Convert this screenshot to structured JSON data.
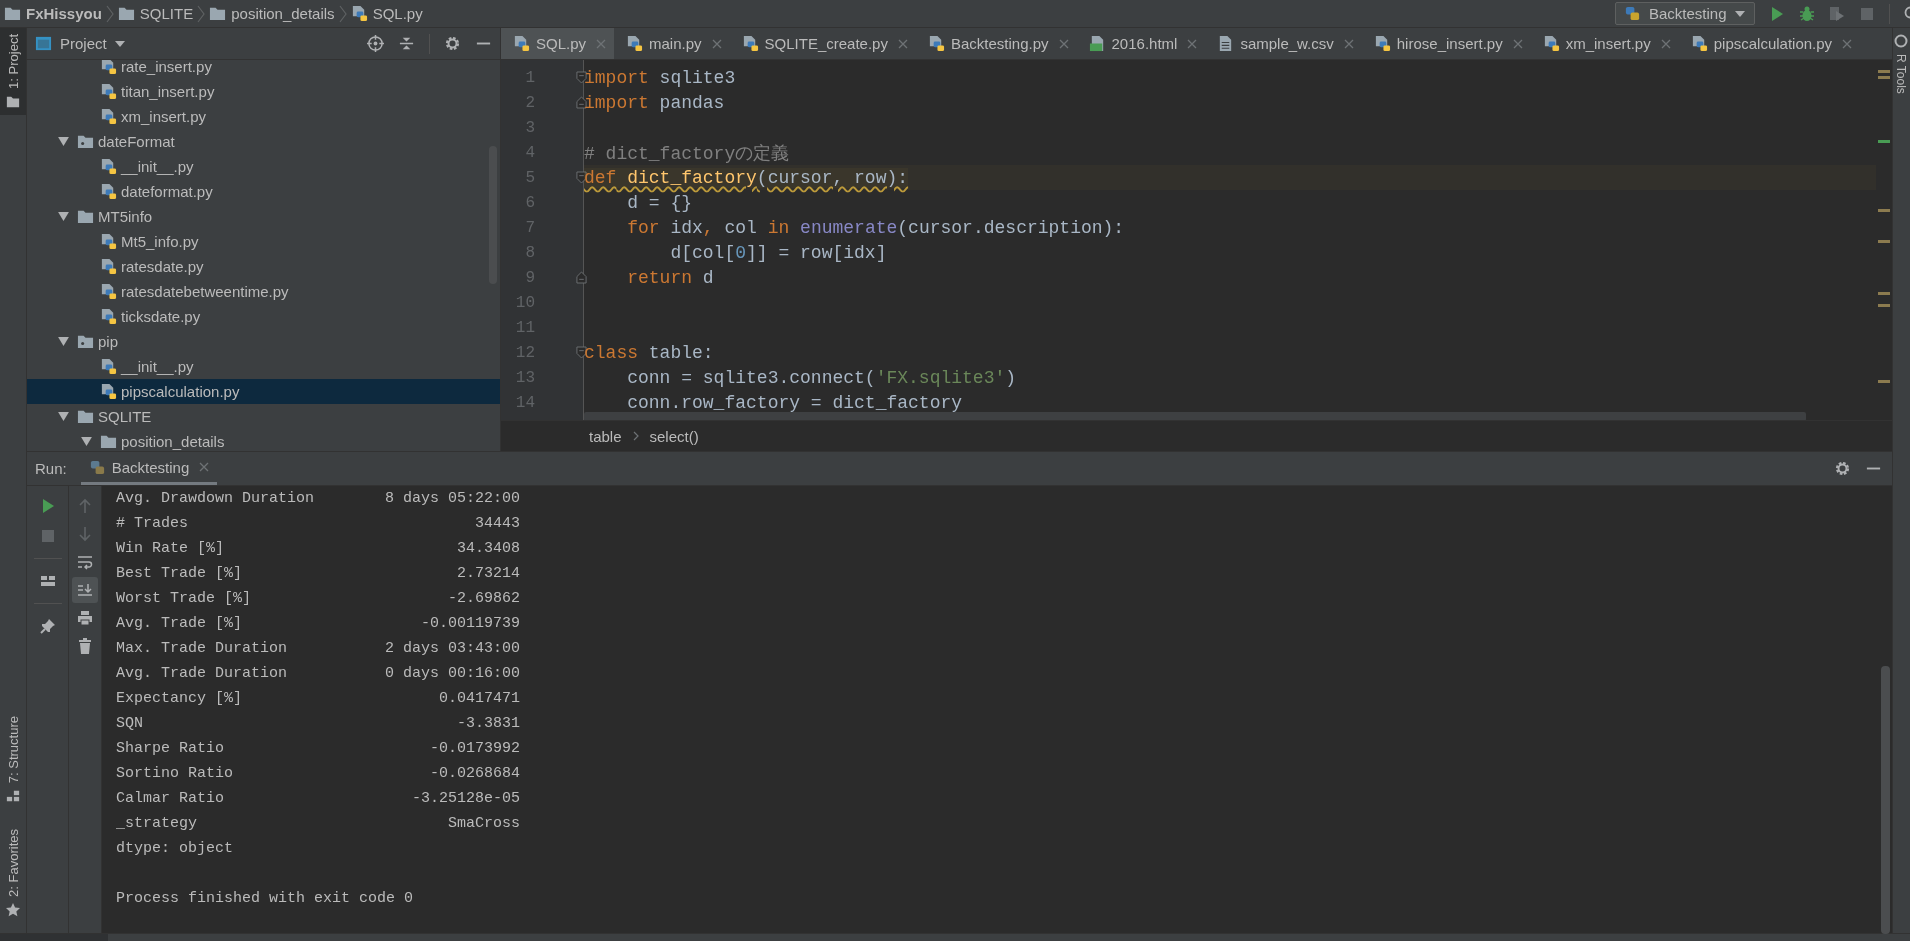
{
  "breadcrumbs": [
    {
      "label": "FxHissyou",
      "kind": "project"
    },
    {
      "label": "SQLITE",
      "kind": "folder"
    },
    {
      "label": "position_details",
      "kind": "folder"
    },
    {
      "label": "SQL.py",
      "kind": "python"
    }
  ],
  "run_config": {
    "label": "Backtesting"
  },
  "left_tool_tabs_top": [
    {
      "label": "1: Project",
      "kind": "project",
      "selected": true
    }
  ],
  "left_tool_tabs_bottom": [
    {
      "label": "7: Structure",
      "kind": "structure",
      "selected": false
    },
    {
      "label": "2: Favorites",
      "kind": "favorites",
      "selected": false
    }
  ],
  "right_tool_tabs": [
    {
      "label": "R Tools",
      "selected": false
    }
  ],
  "project_panel": {
    "title": "Project",
    "tree": [
      {
        "name": "rate_insert.py",
        "kind": "file",
        "selected": false
      },
      {
        "name": "titan_insert.py",
        "kind": "file",
        "selected": false
      },
      {
        "name": "xm_insert.py",
        "kind": "file",
        "selected": false
      },
      {
        "name": "dateFormat",
        "kind": "package",
        "expanded": true,
        "selected": false,
        "children": [
          {
            "name": "__init__.py",
            "kind": "file",
            "selected": false
          },
          {
            "name": "dateformat.py",
            "kind": "file",
            "selected": false
          }
        ]
      },
      {
        "name": "MT5info",
        "kind": "folder",
        "expanded": true,
        "selected": false,
        "children": [
          {
            "name": "Mt5_info.py",
            "kind": "file",
            "selected": false
          },
          {
            "name": "ratesdate.py",
            "kind": "file",
            "selected": false
          },
          {
            "name": "ratesdatebetweentime.py",
            "kind": "file",
            "selected": false
          },
          {
            "name": "ticksdate.py",
            "kind": "file",
            "selected": false
          }
        ]
      },
      {
        "name": "pip",
        "kind": "package",
        "expanded": true,
        "selected": false,
        "children": [
          {
            "name": "__init__.py",
            "kind": "file",
            "selected": false
          },
          {
            "name": "pipscalculation.py",
            "kind": "file",
            "selected": true
          }
        ]
      },
      {
        "name": "SQLITE",
        "kind": "folder",
        "expanded": true,
        "selected": false,
        "children": [
          {
            "name": "position_details",
            "kind": "folder",
            "expanded": true,
            "selected": false
          }
        ]
      }
    ]
  },
  "editor": {
    "tabs": [
      {
        "label": "SQL.py",
        "kind": "python",
        "selected": true
      },
      {
        "label": "main.py",
        "kind": "python",
        "selected": false
      },
      {
        "label": "SQLITE_create.py",
        "kind": "python",
        "selected": false
      },
      {
        "label": "Backtesting.py",
        "kind": "python",
        "selected": false
      },
      {
        "label": "2016.html",
        "kind": "html",
        "selected": false
      },
      {
        "label": "sample_w.csv",
        "kind": "text",
        "selected": false
      },
      {
        "label": "hirose_insert.py",
        "kind": "python",
        "selected": false
      },
      {
        "label": "xm_insert.py",
        "kind": "python",
        "selected": false
      },
      {
        "label": "pipscalculation.py",
        "kind": "python",
        "selected": false
      }
    ],
    "lines": [
      {
        "number": "1",
        "fold_open": true,
        "fold_close": false,
        "warning": false,
        "tokens": [
          {
            "kind": "keyword",
            "text": "import"
          },
          {
            "kind": "plain",
            "text": " sqlite3"
          }
        ]
      },
      {
        "number": "2",
        "fold_open": false,
        "fold_close": true,
        "warning": false,
        "tokens": [
          {
            "kind": "keyword",
            "text": "import"
          },
          {
            "kind": "plain",
            "text": " pandas"
          }
        ]
      },
      {
        "number": "3",
        "fold_open": false,
        "fold_close": false,
        "warning": false
      },
      {
        "number": "4",
        "fold_open": false,
        "fold_close": false,
        "warning": false,
        "tokens": [
          {
            "kind": "comment",
            "text": "# dict_factoryの定義"
          }
        ]
      },
      {
        "number": "5",
        "fold_open": true,
        "fold_close": false,
        "warning": true,
        "tokens": [
          {
            "kind": "keyword",
            "text": "def"
          },
          {
            "kind": "function",
            "text": " dict_factory"
          },
          {
            "kind": "plain",
            "text": "(cursor, row):"
          }
        ]
      },
      {
        "number": "6",
        "fold_open": false,
        "fold_close": false,
        "warning": false,
        "tokens": [
          {
            "kind": "plain",
            "text": "    d = {}"
          }
        ]
      },
      {
        "number": "7",
        "fold_open": false,
        "fold_close": false,
        "warning": false,
        "tokens": [
          {
            "kind": "keyword",
            "text": "    for"
          },
          {
            "kind": "plain",
            "text": " idx"
          },
          {
            "kind": "keyword",
            "text": ","
          },
          {
            "kind": "plain",
            "text": " col "
          },
          {
            "kind": "keyword",
            "text": "in"
          },
          {
            "kind": "builtin",
            "text": " enumerate"
          },
          {
            "kind": "plain",
            "text": "(cursor.description):"
          }
        ]
      },
      {
        "number": "8",
        "fold_open": false,
        "fold_close": false,
        "warning": false,
        "tokens": [
          {
            "kind": "plain",
            "text": "        d[col["
          },
          {
            "kind": "number",
            "text": "0"
          },
          {
            "kind": "plain",
            "text": "]] = row[idx]"
          }
        ]
      },
      {
        "number": "9",
        "fold_open": false,
        "fold_close": true,
        "warning": false,
        "tokens": [
          {
            "kind": "keyword",
            "text": "    return"
          },
          {
            "kind": "plain",
            "text": " d"
          }
        ]
      },
      {
        "number": "10",
        "fold_open": false,
        "fold_close": false,
        "warning": false
      },
      {
        "number": "11",
        "fold_open": false,
        "fold_close": false,
        "warning": false
      },
      {
        "number": "12",
        "fold_open": true,
        "fold_close": false,
        "warning": false,
        "tokens": [
          {
            "kind": "keyword",
            "text": "class"
          },
          {
            "kind": "plain",
            "text": " table:"
          }
        ]
      },
      {
        "number": "13",
        "fold_open": false,
        "fold_close": false,
        "warning": false,
        "tokens": [
          {
            "kind": "plain",
            "text": "    conn = sqlite3.connect("
          },
          {
            "kind": "string",
            "text": "'FX.sqlite3'"
          },
          {
            "kind": "plain",
            "text": ")"
          }
        ]
      },
      {
        "number": "14",
        "fold_open": false,
        "fold_close": false,
        "warning": false,
        "tokens": [
          {
            "kind": "plain",
            "text": "    conn.row_factory = dict_factory"
          }
        ]
      }
    ],
    "breadcrumb": [
      "table",
      "select()"
    ]
  },
  "run_panel": {
    "title": "Run:",
    "tab": {
      "label": "Backtesting",
      "selected": true
    },
    "rows": [
      {
        "label": "Avg. Drawdown Duration",
        "value": "8 days 05:22:00"
      },
      {
        "label": "# Trades",
        "value": "34443"
      },
      {
        "label": "Win Rate [%]",
        "value": "34.3408"
      },
      {
        "label": "Best Trade [%]",
        "value": "2.73214"
      },
      {
        "label": "Worst Trade [%]",
        "value": "-2.69862"
      },
      {
        "label": "Avg. Trade [%]",
        "value": "-0.00119739"
      },
      {
        "label": "Max. Trade Duration",
        "value": "2 days 03:43:00"
      },
      {
        "label": "Avg. Trade Duration",
        "value": "0 days 00:16:00"
      },
      {
        "label": "Expectancy [%]",
        "value": "0.0417471"
      },
      {
        "label": "SQN",
        "value": "-3.3831"
      },
      {
        "label": "Sharpe Ratio",
        "value": "-0.0173992"
      },
      {
        "label": "Sortino Ratio",
        "value": "-0.0268684"
      },
      {
        "label": "Calmar Ratio",
        "value": "-3.25128e-05"
      },
      {
        "label": "_strategy",
        "value": "SmaCross"
      }
    ],
    "footer_lines": [
      {
        "text": "dtype: object",
        "gap_before": false
      },
      {
        "text": "Process finished with exit code 0",
        "gap_before": true
      }
    ]
  }
}
